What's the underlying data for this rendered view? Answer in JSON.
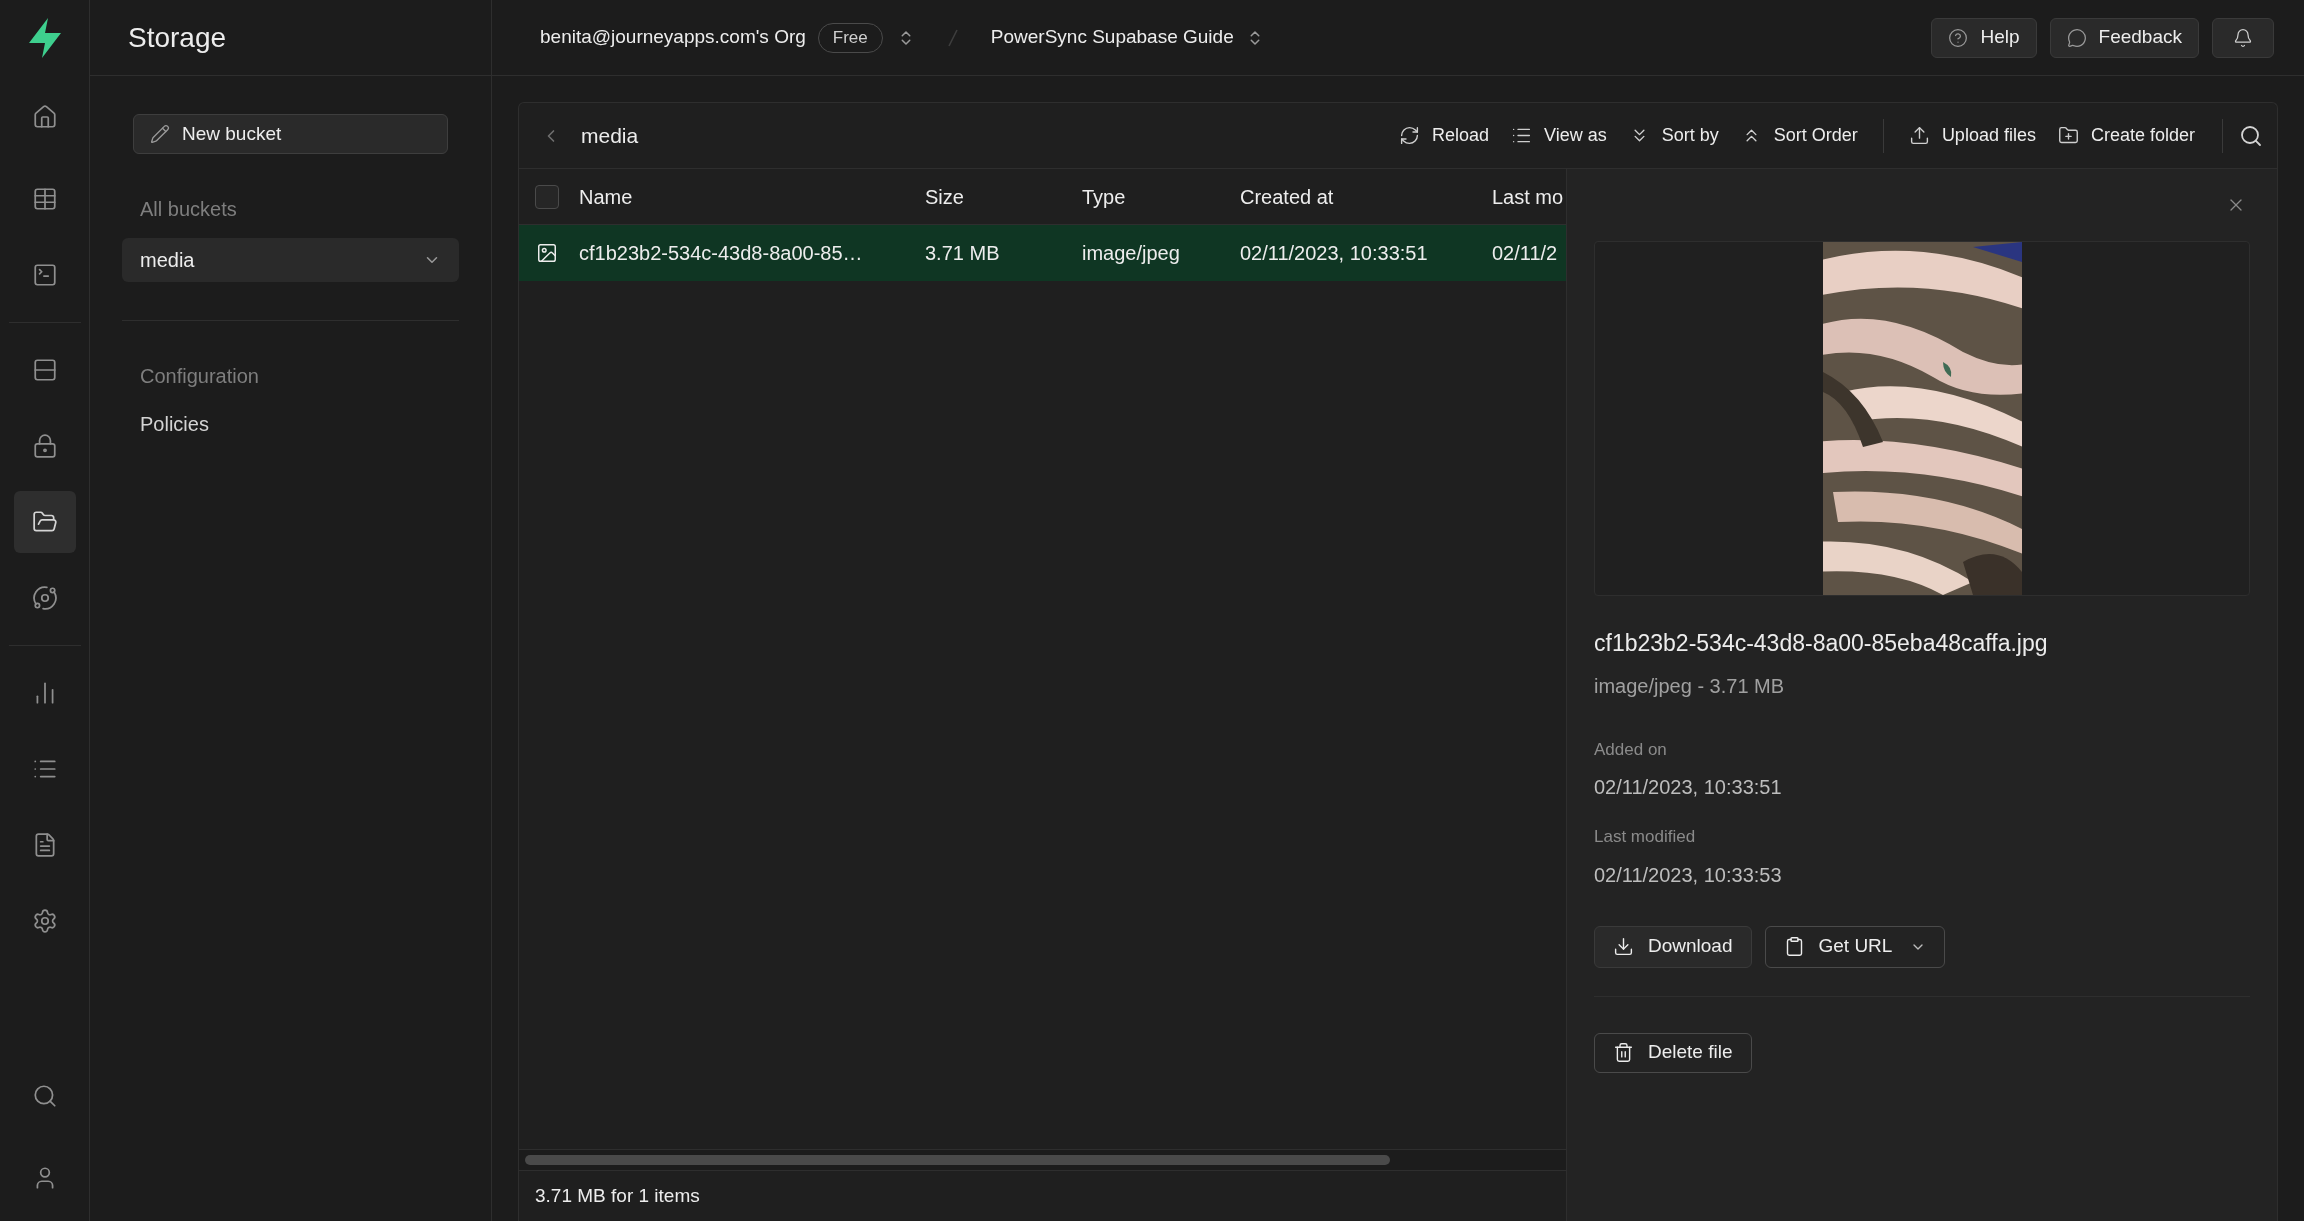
{
  "nav_rail": {
    "groups": [
      [
        {
          "selected": false
        }
      ],
      [
        {
          "selected": false
        },
        {
          "selected": false
        }
      ],
      [
        {
          "selected": false
        },
        {
          "selected": false
        },
        {
          "selected": true
        },
        {
          "selected": false
        }
      ],
      [
        {
          "selected": false
        },
        {
          "selected": false
        },
        {
          "selected": false
        },
        {
          "selected": false
        }
      ]
    ],
    "bottom": [
      {
        "selected": false
      },
      {
        "selected": false
      }
    ]
  },
  "sidebar": {
    "title": "Storage",
    "new_bucket": "New bucket",
    "buckets_heading": "All buckets",
    "buckets": [
      {
        "label": "media",
        "selected": true
      }
    ],
    "config_heading": "Configuration",
    "config_items": [
      {
        "label": "Policies",
        "selected": false
      }
    ]
  },
  "header": {
    "org": "benita@journeyapps.com's Org",
    "plan": "Free",
    "project": "PowerSync Supabase Guide",
    "buttons": [
      "Help",
      "Feedback"
    ]
  },
  "toolbar": {
    "path": "media",
    "action_groups": [
      [
        "Reload",
        "View as",
        "Sort by",
        "Sort Order"
      ],
      [
        "Upload files",
        "Create folder"
      ]
    ]
  },
  "table": {
    "select_all_checked": false,
    "columns": [
      "Name",
      "Size",
      "Type",
      "Created at",
      "Last mo"
    ],
    "rows": [
      {
        "selected": true,
        "checked": false,
        "cells": [
          "cf1b23b2-534c-43d8-8a00-85…",
          "3.71 MB",
          "image/jpeg",
          "02/11/2023, 10:33:51",
          "02/11/2"
        ]
      }
    ]
  },
  "footer": "3.71 MB for 1 items",
  "details": {
    "filename": "cf1b23b2-534c-43d8-8a00-85eba48caffa.jpg",
    "subtitle": "image/jpeg - 3.71 MB",
    "fields": [
      {
        "label": "Added on",
        "value": "02/11/2023, 10:33:51"
      },
      {
        "label": "Last modified",
        "value": "02/11/2023, 10:33:53"
      }
    ],
    "download": "Download",
    "get_url": "Get URL",
    "delete": "Delete file"
  }
}
